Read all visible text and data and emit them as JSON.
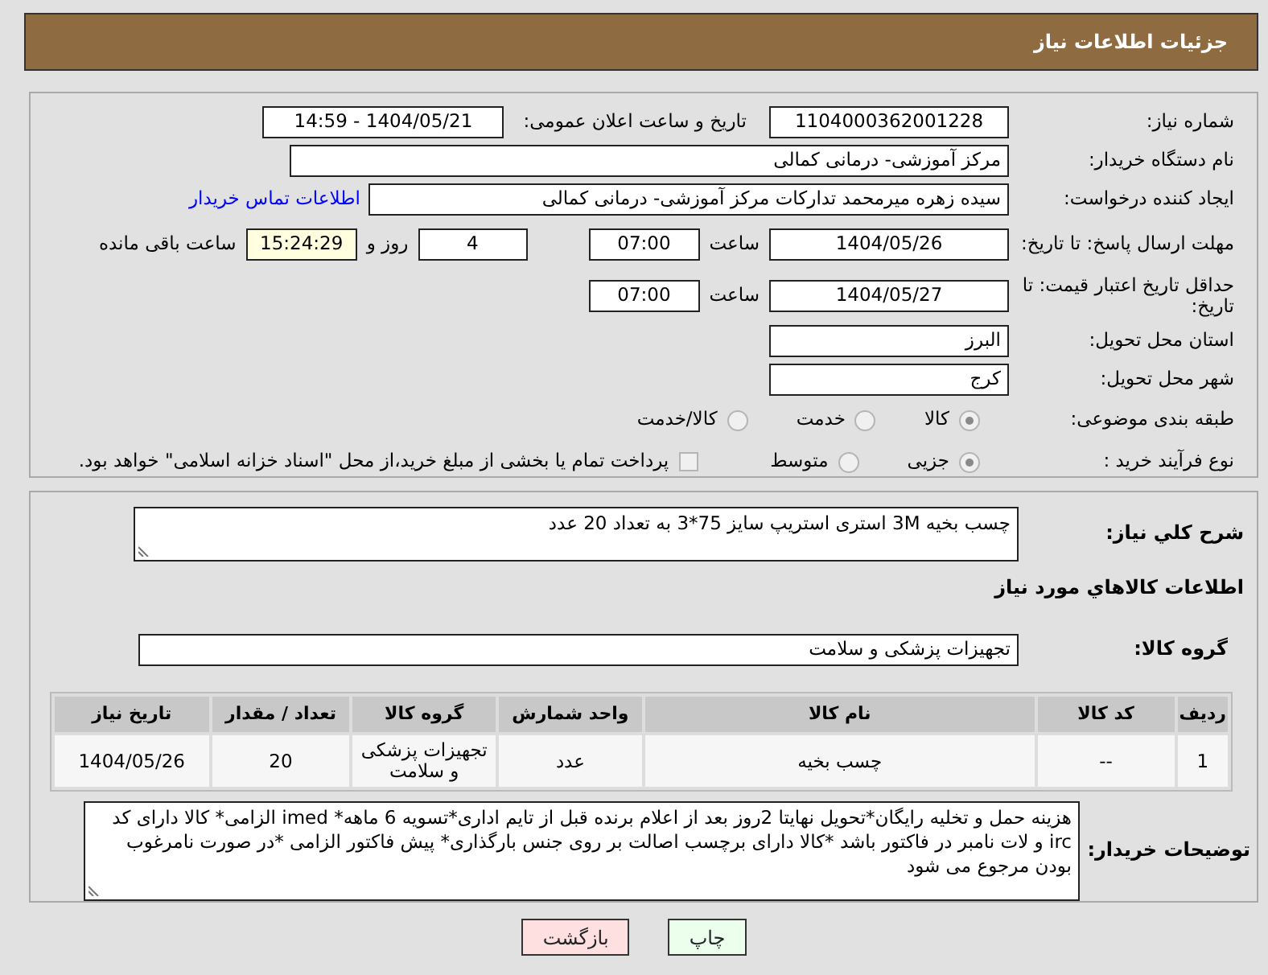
{
  "header": {
    "title": "جزئیات اطلاعات نیاز"
  },
  "need_number": {
    "label": "شماره نیاز:",
    "value": "1104000362001228"
  },
  "announce": {
    "label": "تاریخ و ساعت اعلان عمومی:",
    "value": "1404/05/21 - 14:59"
  },
  "buyer_org": {
    "label": "نام دستگاه خریدار:",
    "value": "مرکز آموزشی- درمانی کمالی"
  },
  "requester": {
    "label": "ایجاد کننده درخواست:",
    "value": "سیده زهره میرمحمد تدارکات مرکز آموزشی- درمانی کمالی",
    "link": "اطلاعات تماس خریدار"
  },
  "deadline": {
    "label": "مهلت ارسال پاسخ: تا تاریخ:",
    "date": "1404/05/26",
    "time_label": "ساعت",
    "time": "07:00",
    "days": "4",
    "days_label": "روز و",
    "remaining": "15:24:29",
    "remaining_label": "ساعت باقی مانده"
  },
  "price_validity": {
    "label": "حداقل تاریخ اعتبار قیمت: تا تاریخ:",
    "date": "1404/05/27",
    "time_label": "ساعت",
    "time": "07:00"
  },
  "province": {
    "label": "استان محل تحویل:",
    "value": "البرز"
  },
  "city": {
    "label": "شهر محل تحویل:",
    "value": "کرج"
  },
  "category": {
    "label": "طبقه بندی موضوعی:",
    "options": [
      {
        "label": "کالا",
        "selected": true
      },
      {
        "label": "خدمت",
        "selected": false
      },
      {
        "label": "کالا/خدمت",
        "selected": false
      }
    ]
  },
  "process": {
    "label": "نوع فرآیند خرید :",
    "options": [
      {
        "label": "جزیی",
        "selected": true
      },
      {
        "label": "متوسط",
        "selected": false
      }
    ],
    "payment_note": {
      "label": "پرداخت تمام یا بخشی از مبلغ خرید،از محل \"اسناد خزانه اسلامی\" خواهد بود.",
      "checked": false
    }
  },
  "description": {
    "label": "شرح کلي نياز:",
    "value": "چسب بخیه 3M استری استریپ سایز 75*3 به تعداد 20 عدد"
  },
  "goods_heading": "اطلاعات کالاهاي مورد نياز",
  "goods_group": {
    "label": "گروه کالا:",
    "value": "تجهیزات پزشکی و سلامت"
  },
  "table": {
    "columns": [
      "ردیف",
      "کد کالا",
      "نام کالا",
      "واحد شمارش",
      "گروه کالا",
      "تعداد / مقدار",
      "تاریخ نیاز"
    ],
    "rows": [
      [
        "1",
        "--",
        "چسب بخیه",
        "عدد",
        "تجهیزات پزشکی و سلامت",
        "20",
        "1404/05/26"
      ]
    ]
  },
  "buyer_notes": {
    "label": "توضیحات خریدار:",
    "value": "هزینه حمل و تخلیه رایگان*تحویل نهایتا 2روز بعد از اعلام برنده قبل از تایم اداری*تسویه 6 ماهه* imed الزامی* کالا دارای کد irc و لات نامبر در فاکتور باشد *کالا دارای برچسب اصالت بر روی جنس بارگذاری* پیش فاکتور الزامی *در صورت نامرغوب بودن مرجوع می شود"
  },
  "buttons": [
    {
      "label": "چاپ",
      "kind": "print"
    },
    {
      "label": "بازگشت",
      "kind": "back"
    }
  ]
}
